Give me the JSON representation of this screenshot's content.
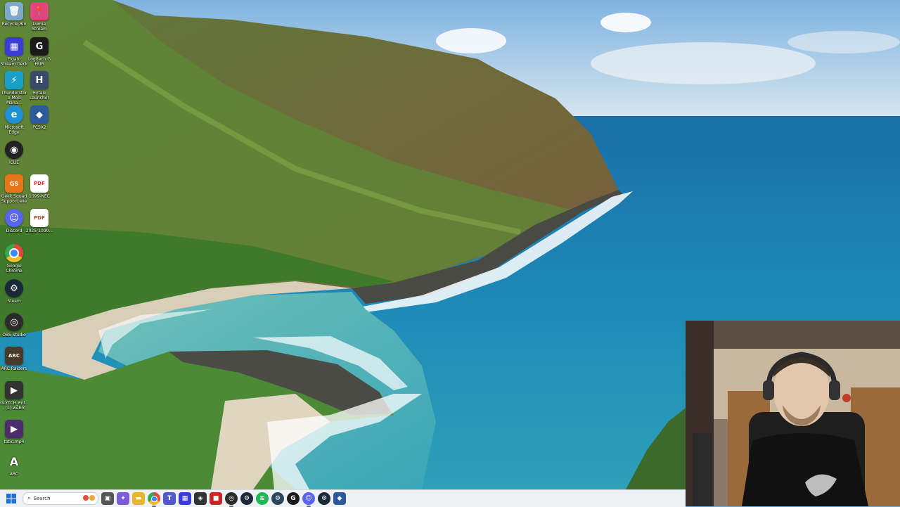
{
  "desktop": {
    "icons": [
      {
        "label": "Recycle Bin",
        "icon": "recycle-bin-icon",
        "color": "#7da8c9",
        "glyph": "🗑"
      },
      {
        "label": "Lumia Stream",
        "icon": "lumia-stream-icon",
        "color": "#e0457b",
        "glyph": "📍"
      },
      {
        "label": "Elgato Stream Deck",
        "icon": "stream-deck-icon",
        "color": "#3b3bd6",
        "glyph": "▦"
      },
      {
        "label": "Logitech G HUB",
        "icon": "logitech-ghub-icon",
        "color": "#1a1a1a",
        "glyph": "G"
      },
      {
        "label": "Thunderstore Mod Mana...",
        "icon": "thunderstore-icon",
        "color": "#1aa0c8",
        "glyph": "⚡"
      },
      {
        "label": "Hytale Launcher",
        "icon": "hytale-icon",
        "color": "#3a4a6a",
        "glyph": "H"
      },
      {
        "label": "Microsoft Edge",
        "icon": "edge-icon",
        "color": "#1f8fd6",
        "glyph": "e"
      },
      {
        "label": "PCSX2",
        "icon": "pcsx2-icon",
        "color": "#2d5a9b",
        "glyph": "◆"
      },
      {
        "label": "iCUE",
        "icon": "icue-icon",
        "color": "#222",
        "glyph": "◉"
      },
      {
        "label": "Geek Squad Support.exe",
        "icon": "geek-squad-icon",
        "color": "#e8761b",
        "glyph": "GS"
      },
      {
        "label": "1099-NEC",
        "icon": "pdf-icon",
        "color": "#d93a2b",
        "glyph": "PDF"
      },
      {
        "label": "Discord",
        "icon": "discord-icon",
        "color": "#5865f2",
        "glyph": "☺"
      },
      {
        "label": "2025-1099...",
        "icon": "pdf-icon",
        "color": "#d93a2b",
        "glyph": "PDF"
      },
      {
        "label": "Google Chrome",
        "icon": "chrome-icon",
        "color": "#e8453c",
        "glyph": "●"
      },
      {
        "label": "Steam",
        "icon": "steam-icon",
        "color": "#1b2838",
        "glyph": "⚙"
      },
      {
        "label": "OBS Studio",
        "icon": "obs-icon",
        "color": "#2b2b2b",
        "glyph": "◎"
      },
      {
        "label": "ARC Raiders",
        "icon": "arc-raiders-icon",
        "color": "#4a3a2a",
        "glyph": "ARC"
      },
      {
        "label": "GLYTCH_Ent... (1).webm",
        "icon": "video-file-icon",
        "color": "#333",
        "glyph": "▶"
      },
      {
        "label": "tatic.mp4",
        "icon": "video-file-icon",
        "color": "#4b2d6b",
        "glyph": "▶"
      },
      {
        "label": "ARC",
        "icon": "arc-icon",
        "color": "#ffffff",
        "glyph": "A"
      }
    ]
  },
  "taskbar": {
    "search_placeholder": "Search",
    "apps": [
      {
        "name": "taskbar-task-view",
        "icon": "task-view-icon",
        "color": "#555",
        "glyph": "▣"
      },
      {
        "name": "taskbar-copilot",
        "icon": "copilot-icon",
        "color": "#7b5cd6",
        "glyph": "✦"
      },
      {
        "name": "taskbar-file-explorer",
        "icon": "folder-icon",
        "color": "#e9b530",
        "glyph": "▬"
      },
      {
        "name": "taskbar-chrome",
        "icon": "chrome-icon",
        "color": "#e8453c",
        "glyph": "●"
      },
      {
        "name": "taskbar-teams",
        "icon": "teams-icon",
        "color": "#5059c9",
        "glyph": "T"
      },
      {
        "name": "taskbar-stream-deck",
        "icon": "stream-deck-icon",
        "color": "#3b3bd6",
        "glyph": "▦"
      },
      {
        "name": "taskbar-app-red",
        "icon": "app-icon",
        "color": "#333",
        "glyph": "◈"
      },
      {
        "name": "taskbar-app-box",
        "icon": "app-icon",
        "color": "#c62828",
        "glyph": "■"
      },
      {
        "name": "taskbar-obs",
        "icon": "obs-icon",
        "color": "#2b2b2b",
        "glyph": "◎"
      },
      {
        "name": "taskbar-steam",
        "icon": "steam-icon",
        "color": "#1b2838",
        "glyph": "⚙"
      },
      {
        "name": "taskbar-spotify",
        "icon": "spotify-icon",
        "color": "#1db954",
        "glyph": "≋"
      },
      {
        "name": "taskbar-steam-2",
        "icon": "steam-icon",
        "color": "#2a475e",
        "glyph": "⚙"
      },
      {
        "name": "taskbar-ghub",
        "icon": "logitech-ghub-icon",
        "color": "#1a1a1a",
        "glyph": "G"
      },
      {
        "name": "taskbar-discord",
        "icon": "discord-icon",
        "color": "#5865f2",
        "glyph": "☺"
      },
      {
        "name": "taskbar-steam-3",
        "icon": "steam-icon",
        "color": "#1b2838",
        "glyph": "⚙"
      },
      {
        "name": "taskbar-pcsx2",
        "icon": "pcsx2-icon",
        "color": "#2d5a9b",
        "glyph": "◆"
      }
    ]
  }
}
